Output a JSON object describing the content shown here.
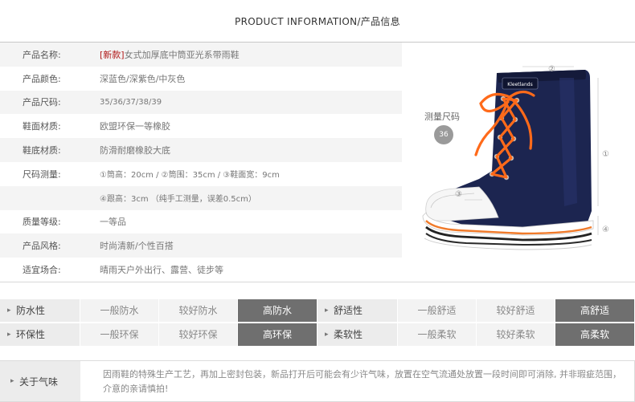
{
  "header": {
    "title": "PRODUCT INFORMATION/产品信息"
  },
  "spec": {
    "rows": [
      {
        "label": "产品名称:",
        "tag": "[新款]",
        "value": "女式加厚底中筒亚光系带雨鞋"
      },
      {
        "label": "产品颜色:",
        "value": "深蓝色/深紫色/中灰色"
      },
      {
        "label": "产品尺码:",
        "value": "35/36/37/38/39"
      },
      {
        "label": "鞋面材质:",
        "value": "欧盟环保一等橡胶"
      },
      {
        "label": "鞋底材质:",
        "value": "防滑耐磨橡胶大底"
      },
      {
        "label": "尺码测量:",
        "value": "①筒高：20cm / ②筒围：35cm / ③鞋面宽：9cm"
      },
      {
        "label": "",
        "value": "④跟高：3cm （纯手工测量，误差0.5cm）"
      },
      {
        "label": "质量等级:",
        "value": "一等品"
      },
      {
        "label": "产品风格:",
        "value": "时尚清新/个性百搭"
      },
      {
        "label": "适宜场合:",
        "value": "晴雨天户外出行、露营、徒步等"
      }
    ]
  },
  "product": {
    "measure_label": "测量尺码",
    "measure_size": "36",
    "markers": [
      "①",
      "②",
      "③",
      "④"
    ],
    "brand_label": "Kleetlands"
  },
  "ratings": [
    {
      "left": {
        "label": "防水性",
        "options": [
          "一般防水",
          "较好防水",
          "高防水"
        ],
        "selected": 2
      },
      "right": {
        "label": "舒适性",
        "options": [
          "一般舒适",
          "较好舒适",
          "高舒适"
        ],
        "selected": 2
      }
    },
    {
      "left": {
        "label": "环保性",
        "options": [
          "一般环保",
          "较好环保",
          "高环保"
        ],
        "selected": 2
      },
      "right": {
        "label": "柔软性",
        "options": [
          "一般柔软",
          "较好柔软",
          "高柔软"
        ],
        "selected": 2
      }
    }
  ],
  "notice": {
    "label": "关于气味",
    "text": "因雨鞋的特殊生产工艺，再加上密封包装，新品打开后可能会有少许气味，放置在空气流通处放置一段时间即可消除, 并非瑕疵范围，介意的亲请慎拍!"
  },
  "colors": {
    "boot": "#1c2550",
    "laces": "#ff6a1a",
    "sole_stripe": "#f07a2a",
    "selected": "#6f6f6f"
  }
}
